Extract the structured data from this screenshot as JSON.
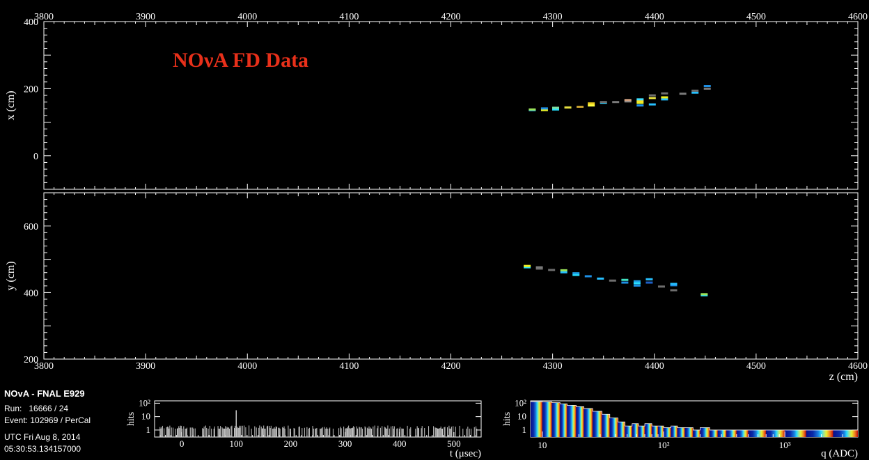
{
  "banner": "NOνA FD Data",
  "info": {
    "experiment": "NOvA - FNAL E929",
    "run": "Run:   16666 / 24",
    "event": "Event: 102969 / PerCal",
    "date": "UTC Fri Aug 8, 2014",
    "time": "05:30:53.134157000"
  },
  "colors": {
    "banner": "#e8301a",
    "frame": "#ffffff",
    "hist_fill": "#08108a",
    "hist_line": "#ffffff",
    "time_bars": "#c8c8c8"
  },
  "chart_data": [
    {
      "name": "xz-view",
      "type": "scatter",
      "xlim": [
        3800,
        4600
      ],
      "ylim": [
        -100,
        400
      ],
      "x_ticks": [
        "3800",
        "3900",
        "4000",
        "4100",
        "4200",
        "4300",
        "4400",
        "4500",
        "4600"
      ],
      "y_ticks": [
        "0",
        "200",
        "400"
      ],
      "ylabel": "x (cm)",
      "hits": [
        {
          "z": 4280,
          "x": 136,
          "c": "#27c0ff"
        },
        {
          "z": 4280,
          "x": 138,
          "c": "#9be35a"
        },
        {
          "z": 4292,
          "x": 136,
          "c": "#e6f02a"
        },
        {
          "z": 4292,
          "x": 141,
          "c": "#1e90e6"
        },
        {
          "z": 4303,
          "x": 138,
          "c": "#27e0ff"
        },
        {
          "z": 4303,
          "x": 143,
          "c": "#7fe0a0"
        },
        {
          "z": 4315,
          "x": 144,
          "c": "#e6e040"
        },
        {
          "z": 4327,
          "x": 146,
          "c": "#c8a030"
        },
        {
          "z": 4338,
          "x": 150,
          "c": "#ffff40"
        },
        {
          "z": 4338,
          "x": 156,
          "c": "#f0d020"
        },
        {
          "z": 4350,
          "x": 158,
          "c": "#2ad0ff"
        },
        {
          "z": 4350,
          "x": 160,
          "c": "#6e6e6e"
        },
        {
          "z": 4362,
          "x": 160,
          "c": "#7a7a7a"
        },
        {
          "z": 4374,
          "x": 162,
          "c": "#8a8a8a"
        },
        {
          "z": 4374,
          "x": 166,
          "c": "#d0a080"
        },
        {
          "z": 4386,
          "x": 150,
          "c": "#1e90e6"
        },
        {
          "z": 4386,
          "x": 158,
          "c": "#e6f02a"
        },
        {
          "z": 4386,
          "x": 163,
          "c": "#ffe020"
        },
        {
          "z": 4386,
          "x": 168,
          "c": "#40e0ff"
        },
        {
          "z": 4398,
          "x": 153,
          "c": "#27c0ff"
        },
        {
          "z": 4398,
          "x": 172,
          "c": "#e6e040"
        },
        {
          "z": 4398,
          "x": 180,
          "c": "#6e6e6e"
        },
        {
          "z": 4410,
          "x": 168,
          "c": "#27c0ff"
        },
        {
          "z": 4410,
          "x": 174,
          "c": "#f0f020"
        },
        {
          "z": 4410,
          "x": 186,
          "c": "#6e6e6e"
        },
        {
          "z": 4428,
          "x": 185,
          "c": "#7a7a7a"
        },
        {
          "z": 4440,
          "x": 188,
          "c": "#27c0ff"
        },
        {
          "z": 4440,
          "x": 194,
          "c": "#6e6e6e"
        },
        {
          "z": 4452,
          "x": 200,
          "c": "#7a7a7a"
        },
        {
          "z": 4452,
          "x": 208,
          "c": "#1e90e6"
        }
      ]
    },
    {
      "name": "yz-view",
      "type": "scatter",
      "xlim": [
        3800,
        4600
      ],
      "ylim": [
        200,
        700
      ],
      "x_ticks": [
        "3800",
        "3900",
        "4000",
        "4100",
        "4200",
        "4300",
        "4400",
        "4500",
        "4600"
      ],
      "y_ticks": [
        "200",
        "400",
        "600"
      ],
      "ylabel": "y (cm)",
      "xlabel": "z (cm)",
      "hits": [
        {
          "z": 4275,
          "y": 476,
          "c": "#27e0ff"
        },
        {
          "z": 4275,
          "y": 480,
          "c": "#f0f020"
        },
        {
          "z": 4287,
          "y": 472,
          "c": "#6e6e6e"
        },
        {
          "z": 4287,
          "y": 476,
          "c": "#7a7a7a"
        },
        {
          "z": 4299,
          "y": 468,
          "c": "#6e6e6e"
        },
        {
          "z": 4311,
          "y": 461,
          "c": "#27c0ff"
        },
        {
          "z": 4311,
          "y": 467,
          "c": "#9be35a"
        },
        {
          "z": 4323,
          "y": 453,
          "c": "#27e0ff"
        },
        {
          "z": 4323,
          "y": 458,
          "c": "#1ea0e6"
        },
        {
          "z": 4335,
          "y": 449,
          "c": "#1e90e6"
        },
        {
          "z": 4347,
          "y": 442,
          "c": "#27c0ff"
        },
        {
          "z": 4359,
          "y": 436,
          "c": "#6e6e6e"
        },
        {
          "z": 4371,
          "y": 430,
          "c": "#1e90e6"
        },
        {
          "z": 4371,
          "y": 438,
          "c": "#40e0c0"
        },
        {
          "z": 4383,
          "y": 421,
          "c": "#1e90e6"
        },
        {
          "z": 4383,
          "y": 428,
          "c": "#27e0ff"
        },
        {
          "z": 4383,
          "y": 434,
          "c": "#1ea0e6"
        },
        {
          "z": 4395,
          "y": 430,
          "c": "#1e60c8"
        },
        {
          "z": 4395,
          "y": 440,
          "c": "#27c0ff"
        },
        {
          "z": 4407,
          "y": 418,
          "c": "#6e6e6e"
        },
        {
          "z": 4419,
          "y": 407,
          "c": "#6e6e6e"
        },
        {
          "z": 4419,
          "y": 422,
          "c": "#1e90e6"
        },
        {
          "z": 4419,
          "y": 426,
          "c": "#27c0ff"
        },
        {
          "z": 4449,
          "y": 392,
          "c": "#27e0ff"
        },
        {
          "z": 4449,
          "y": 395,
          "c": "#9be35a"
        }
      ]
    },
    {
      "name": "time-histogram",
      "type": "bar",
      "xlabel": "t (μsec)",
      "ylabel": "hits",
      "xlim": [
        -50,
        550
      ],
      "log_y": true,
      "ylim": [
        0.3,
        150
      ],
      "x_ticks": [
        "0",
        "100",
        "200",
        "300",
        "400",
        "500"
      ],
      "y_ticks": [
        "1",
        "10",
        "10²"
      ],
      "spike": {
        "t": 100,
        "hits": 30
      }
    },
    {
      "name": "charge-histogram",
      "type": "bar",
      "xlabel": "q (ADC)",
      "ylabel": "hits",
      "log_x": true,
      "log_y": true,
      "xlim": [
        8,
        4000
      ],
      "ylim": [
        0.3,
        150
      ],
      "x_ticks": [
        "10",
        "10²",
        "10³"
      ],
      "y_ticks": [
        "1",
        "10",
        "10²"
      ],
      "bins": [
        {
          "q": 8,
          "h": 130
        },
        {
          "q": 10,
          "h": 125
        },
        {
          "q": 12,
          "h": 110
        },
        {
          "q": 14,
          "h": 90
        },
        {
          "q": 16,
          "h": 70
        },
        {
          "q": 19,
          "h": 55
        },
        {
          "q": 22,
          "h": 40
        },
        {
          "q": 26,
          "h": 25
        },
        {
          "q": 31,
          "h": 15
        },
        {
          "q": 36,
          "h": 8
        },
        {
          "q": 42,
          "h": 4
        },
        {
          "q": 48,
          "h": 2
        },
        {
          "q": 55,
          "h": 3
        },
        {
          "q": 62,
          "h": 2
        },
        {
          "q": 70,
          "h": 3
        },
        {
          "q": 80,
          "h": 2
        },
        {
          "q": 90,
          "h": 2
        },
        {
          "q": 100,
          "h": 1.5
        },
        {
          "q": 115,
          "h": 2
        },
        {
          "q": 130,
          "h": 1.5
        },
        {
          "q": 150,
          "h": 1.5
        },
        {
          "q": 175,
          "h": 1
        },
        {
          "q": 200,
          "h": 1.5
        },
        {
          "q": 240,
          "h": 1
        },
        {
          "q": 280,
          "h": 1
        },
        {
          "q": 330,
          "h": 1
        },
        {
          "q": 400,
          "h": 1
        },
        {
          "q": 500,
          "h": 1
        },
        {
          "q": 700,
          "h": 1
        },
        {
          "q": 1000,
          "h": 1
        },
        {
          "q": 1500,
          "h": 1
        },
        {
          "q": 2500,
          "h": 1
        }
      ]
    }
  ]
}
